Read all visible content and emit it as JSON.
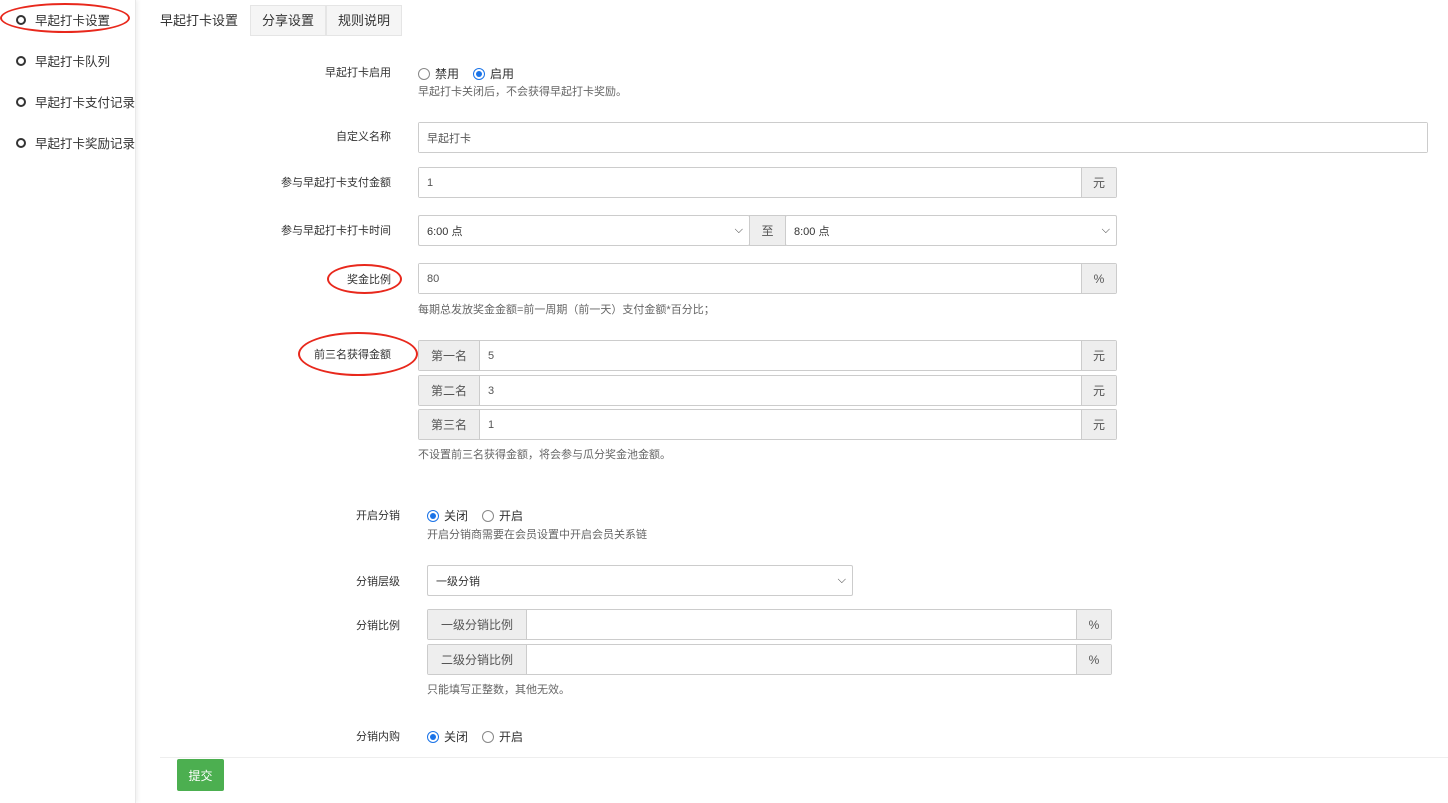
{
  "sidebar": {
    "items": [
      {
        "label": "早起打卡设置"
      },
      {
        "label": "早起打卡队列"
      },
      {
        "label": "早起打卡支付记录"
      },
      {
        "label": "早起打卡奖励记录"
      }
    ]
  },
  "tabs": [
    {
      "label": "早起打卡设置"
    },
    {
      "label": "分享设置"
    },
    {
      "label": "规则说明"
    }
  ],
  "form": {
    "enable": {
      "label": "早起打卡启用",
      "options": [
        "禁用",
        "启用"
      ],
      "selected": "启用",
      "help": "早起打卡关闭后，不会获得早起打卡奖励。"
    },
    "name": {
      "label": "自定义名称",
      "value": "早起打卡"
    },
    "pay": {
      "label": "参与早起打卡支付金额",
      "value": "1",
      "unit": "元"
    },
    "time": {
      "label": "参与早起打卡打卡时间",
      "start": "6:00 点",
      "sep": "至",
      "end": "8:00 点"
    },
    "ratio": {
      "label": "奖金比例",
      "value": "80",
      "unit": "%",
      "help": "每期总发放奖金金额=前一周期（前一天）支付金额*百分比；"
    },
    "top3": {
      "label": "前三名获得金额",
      "rows": [
        {
          "prefix": "第一名",
          "value": "5",
          "unit": "元"
        },
        {
          "prefix": "第二名",
          "value": "3",
          "unit": "元"
        },
        {
          "prefix": "第三名",
          "value": "1",
          "unit": "元"
        }
      ],
      "help": "不设置前三名获得金额，将会参与瓜分奖金池金额。"
    },
    "dist": {
      "label": "开启分销",
      "options": [
        "关闭",
        "开启"
      ],
      "selected": "关闭",
      "help": "开启分销商需要在会员设置中开启会员关系链"
    },
    "level": {
      "label": "分销层级",
      "value": "一级分销"
    },
    "distRatio": {
      "label": "分销比例",
      "rows": [
        {
          "prefix": "一级分销比例",
          "value": "",
          "unit": "%"
        },
        {
          "prefix": "二级分销比例",
          "value": "",
          "unit": "%"
        }
      ],
      "help": "只能填写正整数，其他无效。"
    },
    "inner": {
      "label": "分销内购",
      "options": [
        "关闭",
        "开启"
      ],
      "selected": "关闭"
    }
  },
  "submit_label": "提交"
}
